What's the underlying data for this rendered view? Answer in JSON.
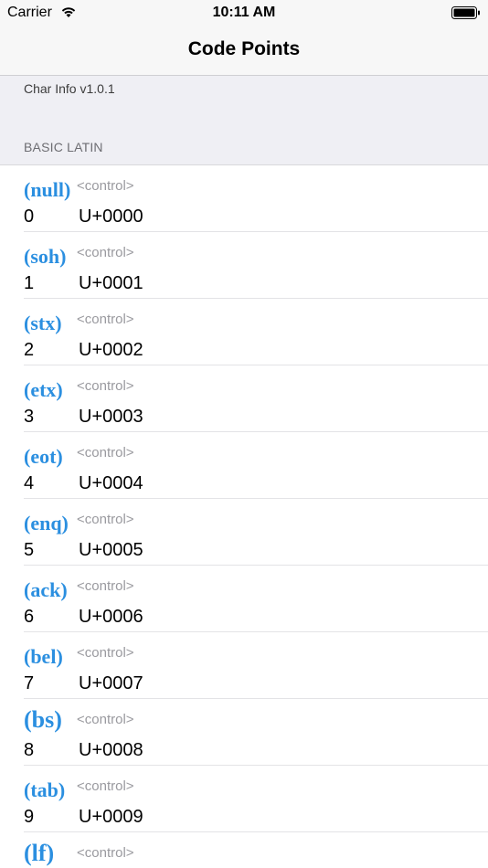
{
  "status_bar": {
    "carrier": "Carrier",
    "time": "10:11 AM"
  },
  "nav": {
    "title": "Code Points"
  },
  "app_version": "Char Info v1.0.1",
  "section": {
    "header": "BASIC LATIN"
  },
  "colors": {
    "accent": "#2b8fe0"
  },
  "rows": [
    {
      "abbr": "(null)",
      "category": "<control>",
      "decimal": "0",
      "code": "U+0000"
    },
    {
      "abbr": "(soh)",
      "category": "<control>",
      "decimal": "1",
      "code": "U+0001"
    },
    {
      "abbr": "(stx)",
      "category": "<control>",
      "decimal": "2",
      "code": "U+0002"
    },
    {
      "abbr": "(etx)",
      "category": "<control>",
      "decimal": "3",
      "code": "U+0003"
    },
    {
      "abbr": "(eot)",
      "category": "<control>",
      "decimal": "4",
      "code": "U+0004"
    },
    {
      "abbr": "(enq)",
      "category": "<control>",
      "decimal": "5",
      "code": "U+0005"
    },
    {
      "abbr": "(ack)",
      "category": "<control>",
      "decimal": "6",
      "code": "U+0006"
    },
    {
      "abbr": "(bel)",
      "category": "<control>",
      "decimal": "7",
      "code": "U+0007"
    },
    {
      "abbr": "(bs)",
      "category": "<control>",
      "decimal": "8",
      "code": "U+0008"
    },
    {
      "abbr": "(tab)",
      "category": "<control>",
      "decimal": "9",
      "code": "U+0009"
    },
    {
      "abbr": "(lf)",
      "category": "<control>",
      "decimal": "",
      "code": ""
    }
  ]
}
